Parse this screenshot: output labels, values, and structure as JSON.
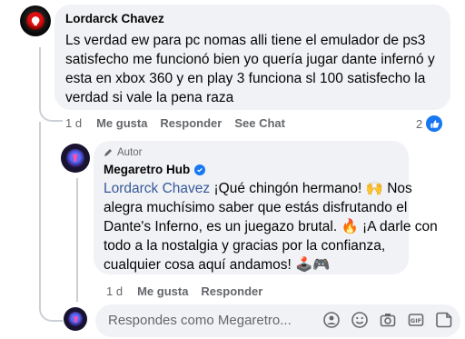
{
  "comment1": {
    "author": "Lordarck Chavez",
    "lines": [
      "Ls verdad ew para pc nomas alli tiene el emulador de ps3",
      "satisfecho me funcionó bien yo quería jugar dante infernó y",
      "esta en xbox 360 y en play 3 funciona sl 100 satisfecho la",
      "verdad si vale la pena raza"
    ],
    "time": "1 d",
    "like_label": "Me gusta",
    "reply_label": "Responder",
    "see_chat_label": "See Chat",
    "reaction_count": "2"
  },
  "reply1": {
    "badge": "Autor",
    "author": "Megaretro Hub",
    "mention": "Lordarck Chavez",
    "line1_rest": " ¡Qué chingón hermano! 🙌 Nos",
    "lines": [
      "alegra muchísimo saber que estás disfrutando el",
      "Dante's Inferno, es un juegazo brutal. 🔥 ¡A darle con",
      "todo a la nostalgia y gracias por la confianza,",
      "cualquier cosa aquí andamos! 🕹️🎮"
    ],
    "time": "1 d",
    "like_label": "Me gusta",
    "reply_label": "Responder"
  },
  "composer": {
    "placeholder": "Respondes como Megaretro..."
  },
  "icons": {
    "verified": "verified-badge-icon",
    "pencil": "pencil-icon",
    "like": "thumbs-up-icon"
  },
  "colors": {
    "bubble": "#f0f2f5",
    "meta": "#65676b",
    "mention": "#385898",
    "verified": "#1877f2"
  }
}
